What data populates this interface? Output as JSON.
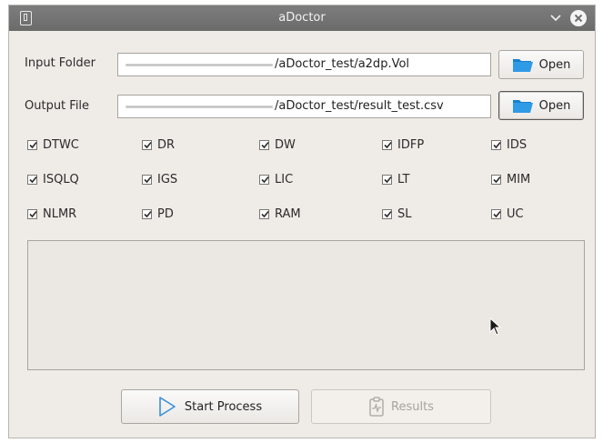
{
  "window": {
    "title": "aDoctor"
  },
  "input_folder": {
    "label": "Input Folder",
    "value": "/aDoctor_test/a2dp.Vol",
    "button": "Open"
  },
  "output_file": {
    "label": "Output File",
    "value": "/aDoctor_test/result_test.csv",
    "button": "Open"
  },
  "checkboxes": [
    {
      "label": "DTWC",
      "checked": true
    },
    {
      "label": "DR",
      "checked": true
    },
    {
      "label": "DW",
      "checked": true
    },
    {
      "label": "IDFP",
      "checked": true
    },
    {
      "label": "IDS",
      "checked": true
    },
    {
      "label": "ISQLQ",
      "checked": true
    },
    {
      "label": "IGS",
      "checked": true
    },
    {
      "label": "LIC",
      "checked": true
    },
    {
      "label": "LT",
      "checked": true
    },
    {
      "label": "MIM",
      "checked": true
    },
    {
      "label": "NLMR",
      "checked": true
    },
    {
      "label": "PD",
      "checked": true
    },
    {
      "label": "RAM",
      "checked": true
    },
    {
      "label": "SL",
      "checked": true
    },
    {
      "label": "UC",
      "checked": true
    }
  ],
  "actions": {
    "start": "Start Process",
    "results": "Results"
  },
  "colors": {
    "folder_blue": "#1e8ad6",
    "play_blue": "#3a8fd9"
  }
}
